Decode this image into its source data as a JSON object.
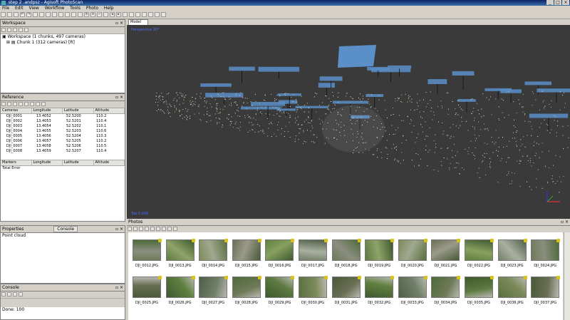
{
  "app": {
    "title": "step 2 .andpsz - Agisoft PhotoScan"
  },
  "menu": [
    "File",
    "Edit",
    "View",
    "Workflow",
    "Tools",
    "Photo",
    "Help"
  ],
  "workspace": {
    "title": "Workspace",
    "tree": [
      {
        "label": "Workspace (1 chunks, 497 cameras)"
      },
      {
        "label": "Chunk 1 (312 cameras) [R]"
      }
    ]
  },
  "reference": {
    "title": "Reference",
    "columns": [
      "Cameras",
      "Longitude",
      "Latitude",
      "Altitude"
    ],
    "rows": [
      [
        "DJI_0001",
        "13.4052",
        "52.5200",
        "110.2"
      ],
      [
        "DJI_0002",
        "13.4053",
        "52.5201",
        "110.4"
      ],
      [
        "DJI_0003",
        "13.4054",
        "52.5202",
        "110.1"
      ],
      [
        "DJI_0004",
        "13.4055",
        "52.5203",
        "110.6"
      ],
      [
        "DJI_0005",
        "13.4056",
        "52.5204",
        "110.3"
      ],
      [
        "DJI_0006",
        "13.4057",
        "52.5205",
        "110.2"
      ],
      [
        "DJI_0007",
        "13.4058",
        "52.5206",
        "110.5"
      ],
      [
        "DJI_0008",
        "13.4059",
        "52.5207",
        "110.4"
      ]
    ],
    "lower_columns": [
      "Markers",
      "Longitude",
      "Latitude",
      "Altitude"
    ],
    "lower_row": "Total Error"
  },
  "properties": {
    "title": "Properties",
    "tab2": "Console",
    "row": "Point cloud"
  },
  "log": {
    "title": "Console",
    "value": "Done: 100"
  },
  "viewport": {
    "tab": "Model",
    "label_tl": "Perspective 30°",
    "label_bl": "Top 0.000"
  },
  "photos": {
    "title": "Photos",
    "row1": [
      "DJI_0012.JPG",
      "DJI_0013.JPG",
      "DJI_0014.JPG",
      "DJI_0015.JPG",
      "DJI_0016.JPG",
      "DJI_0017.JPG",
      "DJI_0018.JPG",
      "DJI_0019.JPG",
      "DJI_0020.JPG",
      "DJI_0021.JPG",
      "DJI_0022.JPG",
      "DJI_0023.JPG",
      "DJI_0024.JPG"
    ],
    "row2": [
      "DJI_0025.JPG",
      "DJI_0026.JPG",
      "DJI_0027.JPG",
      "DJI_0028.JPG",
      "DJI_0029.JPG",
      "DJI_0030.JPG",
      "DJI_0031.JPG",
      "DJI_0032.JPG",
      "DJI_0033.JPG",
      "DJI_0034.JPG",
      "DJI_0035.JPG",
      "DJI_0036.JPG",
      "DJI_0037.JPG"
    ]
  },
  "colors": {
    "scene_bg": "#3a3a3a",
    "camera_blue": "#5a8fc8",
    "accent": "#0a246a"
  }
}
